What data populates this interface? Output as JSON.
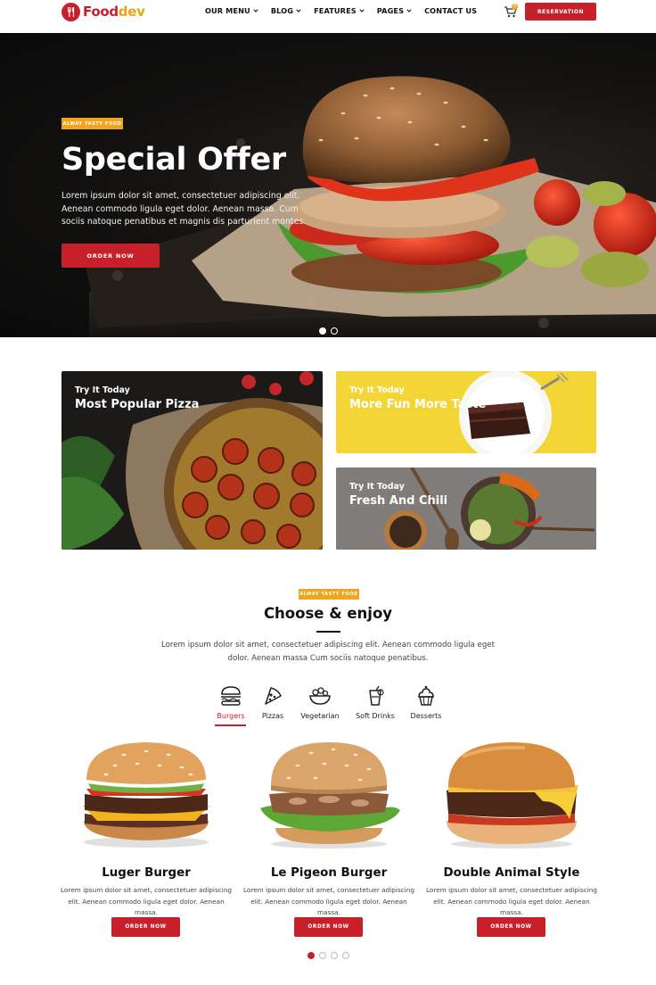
{
  "brand": {
    "name_part1": "Food",
    "name_part2": "dev"
  },
  "nav": {
    "items": [
      {
        "label": "OUR MENU",
        "has_dropdown": true
      },
      {
        "label": "BLOG",
        "has_dropdown": true
      },
      {
        "label": "FEATURES",
        "has_dropdown": true
      },
      {
        "label": "PAGES",
        "has_dropdown": true
      },
      {
        "label": "CONTACT US",
        "has_dropdown": false
      }
    ],
    "cart_icon": "cart-icon",
    "cart_count": "0",
    "reservation_label": "RESERVATION"
  },
  "hero": {
    "tag": "ALWAY TASTY FOOD",
    "title": "Special Offer",
    "text": "Lorem ipsum dolor sit amet, consectetuer adipiscing elit. Aenean commodo ligula eget dolor. Aenean massa. Cum sociis natoque penatibus et magnis dis parturient montes.",
    "button": "ORDER NOW",
    "slides": 2,
    "active_slide": 1
  },
  "promos": [
    {
      "kicker": "Try It Today",
      "title": "Most Popular Pizza"
    },
    {
      "kicker": "Try It Today",
      "title": "More Fun More Taste"
    },
    {
      "kicker": "Try It Today",
      "title": "Fresh And Chili"
    }
  ],
  "menu_section": {
    "tag": "ALWAY TASTY FOOD",
    "title": "Choose & enjoy",
    "text": "Lorem ipsum dolor sit amet, consectetuer adipiscing elit. Aenean commodo ligula eget dolor. Aenean massa Cum sociis natoque penatibus.",
    "tabs": [
      {
        "label": "Burgers",
        "icon": "burger-icon",
        "active": true
      },
      {
        "label": "Pizzas",
        "icon": "pizza-icon",
        "active": false
      },
      {
        "label": "Vegetarian",
        "icon": "salad-bowl-icon",
        "active": false
      },
      {
        "label": "Soft Drinks",
        "icon": "drink-icon",
        "active": false
      },
      {
        "label": "Desserts",
        "icon": "cupcake-icon",
        "active": false
      }
    ],
    "products": [
      {
        "name": "Luger Burger",
        "desc": "Lorem ipsum dolor sit amet, consectetuer adipiscing elit. Aenean commodo ligula eget dolor. Aenean massa.",
        "button": "ORDER NOW"
      },
      {
        "name": "Le Pigeon Burger",
        "desc": "Lorem ipsum dolor sit amet, consectetuer adipiscing elit. Aenean commodo ligula eget dolor. Aenean massa.",
        "button": "ORDER NOW"
      },
      {
        "name": "Double Animal Style",
        "desc": "Lorem ipsum dolor sit amet, consectetuer adipiscing elit. Aenean commodo ligula eget dolor. Aenean massa.",
        "button": "ORDER NOW"
      }
    ],
    "pages": 4,
    "active_page": 1
  },
  "colors": {
    "accent": "#c8202a",
    "tag": "#f0a51f",
    "brand_secondary": "#e8a317"
  }
}
